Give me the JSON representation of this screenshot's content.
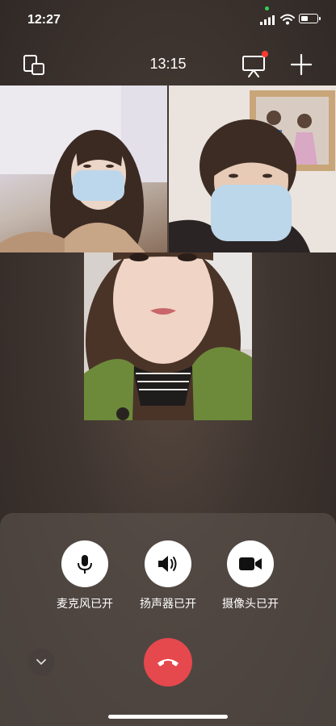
{
  "status_bar": {
    "time": "12:27"
  },
  "top_bar": {
    "call_duration": "13:15"
  },
  "controls": {
    "microphone": {
      "label": "麦克风已开",
      "icon": "microphone-icon"
    },
    "speaker": {
      "label": "扬声器已开",
      "icon": "speaker-icon"
    },
    "camera": {
      "label": "摄像头已开",
      "icon": "video-camera-icon"
    }
  },
  "colors": {
    "hangup": "#e5484d",
    "notification_dot": "#ff3b30",
    "camera_indicator": "#31d158"
  }
}
